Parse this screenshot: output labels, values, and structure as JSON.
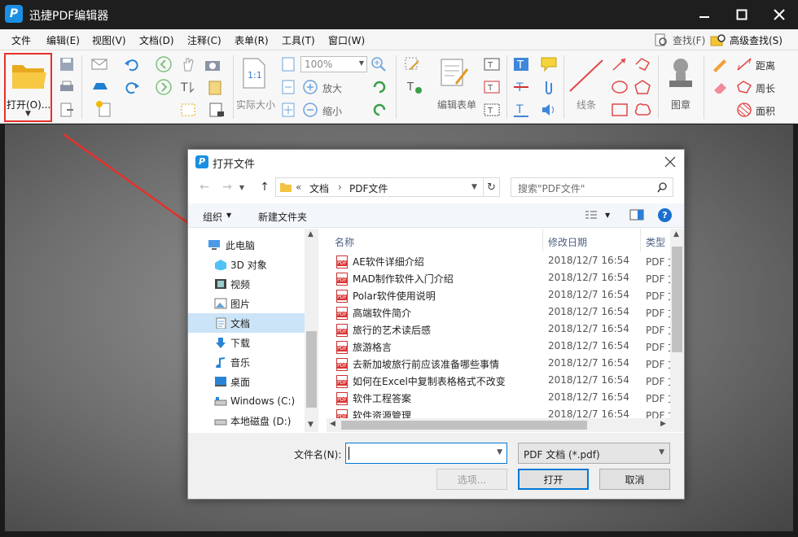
{
  "titlebar": {
    "title": "迅捷PDF编辑器",
    "logo_letter": "P"
  },
  "menu": [
    "文件",
    "编辑(E)",
    "视图(V)",
    "文档(D)",
    "注释(C)",
    "表单(R)",
    "工具(T)",
    "窗口(W)"
  ],
  "menu_right": {
    "find": "查找(F)",
    "advanced_find": "高级查找(S)"
  },
  "toolbar": {
    "open": "打开(O)...",
    "zoom_value": "100%",
    "actual_size": "实际大小",
    "zoom_in": "放大",
    "zoom_out": "缩小",
    "actual_size_icon": "1:1",
    "edit_form": "编辑表单",
    "line": "线条",
    "stamp": "图章",
    "distance": "距离",
    "perimeter": "周长",
    "area": "面积"
  },
  "dialog": {
    "title": "打开文件",
    "breadcrumb": [
      "«",
      "文档",
      "›",
      "PDF文件"
    ],
    "search_placeholder": "搜索\"PDF文件\"",
    "organize": "组织",
    "new_folder": "新建文件夹",
    "nav": [
      {
        "label": "此电脑",
        "icon": "computer-icon"
      },
      {
        "label": "3D 对象",
        "icon": "3d-objects-icon"
      },
      {
        "label": "视频",
        "icon": "video-icon"
      },
      {
        "label": "图片",
        "icon": "pictures-icon"
      },
      {
        "label": "文档",
        "icon": "documents-icon"
      },
      {
        "label": "下载",
        "icon": "download-icon"
      },
      {
        "label": "音乐",
        "icon": "music-icon"
      },
      {
        "label": "桌面",
        "icon": "desktop-icon"
      },
      {
        "label": "Windows (C:)",
        "icon": "drive-icon"
      },
      {
        "label": "本地磁盘 (D:)",
        "icon": "drive-icon"
      }
    ],
    "columns": {
      "name": "名称",
      "date": "修改日期",
      "type": "类型"
    },
    "files": [
      {
        "name": "AE软件详细介绍",
        "date": "2018/12/7 16:54",
        "type": "PDF 文"
      },
      {
        "name": "MAD制作软件入门介绍",
        "date": "2018/12/7 16:54",
        "type": "PDF 文"
      },
      {
        "name": "Polar软件使用说明",
        "date": "2018/12/7 16:54",
        "type": "PDF 文"
      },
      {
        "name": "高端软件简介",
        "date": "2018/12/7 16:54",
        "type": "PDF 文"
      },
      {
        "name": "旅行的艺术读后感",
        "date": "2018/12/7 16:54",
        "type": "PDF 文"
      },
      {
        "name": "旅游格言",
        "date": "2018/12/7 16:54",
        "type": "PDF 文"
      },
      {
        "name": "去新加坡旅行前应该准备哪些事情",
        "date": "2018/12/7 16:54",
        "type": "PDF 文"
      },
      {
        "name": "如何在Excel中复制表格格式不改变",
        "date": "2018/12/7 16:54",
        "type": "PDF 文"
      },
      {
        "name": "软件工程答案",
        "date": "2018/12/7 16:54",
        "type": "PDF 文"
      },
      {
        "name": "软件资源管理",
        "date": "2018/12/7 16:54",
        "type": "PDF 文"
      }
    ],
    "filename_label": "文件名(N):",
    "filename_value": "",
    "filetype": "PDF 文档 (*.pdf)",
    "options_btn": "选项...",
    "open_btn": "打开",
    "cancel_btn": "取消"
  },
  "colors": {
    "accent": "#1a8fe3",
    "highlight": "#e5312b",
    "pdf_red": "#d33333"
  }
}
